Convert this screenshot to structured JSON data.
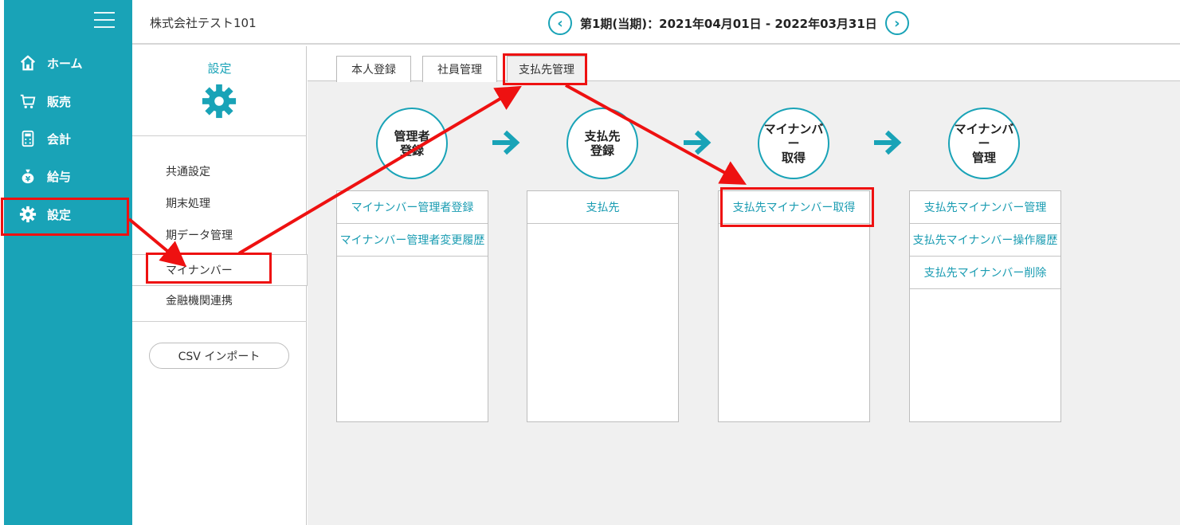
{
  "header": {
    "company": "株式会社テスト101",
    "period": "第1期(当期)：2021年04月01日 - 2022年03月31日",
    "prev_glyph": "‹",
    "next_glyph": "›"
  },
  "nav": {
    "items": [
      {
        "label": "ホーム",
        "icon": "home-icon"
      },
      {
        "label": "販売",
        "icon": "cart-icon"
      },
      {
        "label": "会計",
        "icon": "calculator-icon"
      },
      {
        "label": "給与",
        "icon": "money-bag-icon"
      },
      {
        "label": "設定",
        "icon": "gear-icon"
      }
    ]
  },
  "settings": {
    "title": "設定",
    "menu": [
      "共通設定",
      "期末処理",
      "期データ管理",
      "マイナンバー",
      "金融機関連携"
    ],
    "csv_button": "CSV インポート"
  },
  "tabs": [
    "本人登録",
    "社員管理",
    "支払先管理"
  ],
  "steps": [
    {
      "label": "管理者\n登録"
    },
    {
      "label": "支払先\n登録"
    },
    {
      "label": "マイナンバー\n取得"
    },
    {
      "label": "マイナンバー\n管理"
    }
  ],
  "panels": [
    {
      "links": [
        "マイナンバー管理者登録",
        "マイナンバー管理者変更履歴"
      ]
    },
    {
      "links": [
        "支払先"
      ]
    },
    {
      "links": [
        "支払先マイナンバー取得"
      ]
    },
    {
      "links": [
        "支払先マイナンバー管理",
        "支払先マイナンバー操作履歴",
        "支払先マイナンバー削除"
      ]
    }
  ],
  "colors": {
    "accent": "#19a3b7",
    "annotation": "#ee1111"
  }
}
